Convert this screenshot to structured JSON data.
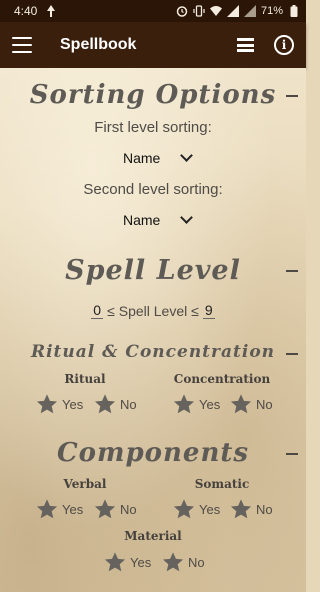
{
  "status_bar": {
    "time": "4:40",
    "battery": "71%"
  },
  "app_bar": {
    "title": "Spellbook"
  },
  "sorting": {
    "title": "Sorting Options",
    "first_label": "First level sorting:",
    "first_value": "Name",
    "second_label": "Second level sorting:",
    "second_value": "Name"
  },
  "spell_level": {
    "title": "Spell Level",
    "min": "0",
    "max": "9",
    "middle": "≤ Spell Level ≤"
  },
  "ritual_conc": {
    "title": "Ritual & Concentration",
    "ritual_label": "Ritual",
    "concentration_label": "Concentration"
  },
  "components": {
    "title": "Components",
    "verbal_label": "Verbal",
    "somatic_label": "Somatic",
    "material_label": "Material"
  },
  "options": {
    "yes": "Yes",
    "no": "No"
  },
  "colors": {
    "status_bar": "#2a1506",
    "app_bar": "#3a1f0c",
    "parchment": "#e6d7b9",
    "heading": "#5e5a55",
    "star": "#66625d"
  }
}
